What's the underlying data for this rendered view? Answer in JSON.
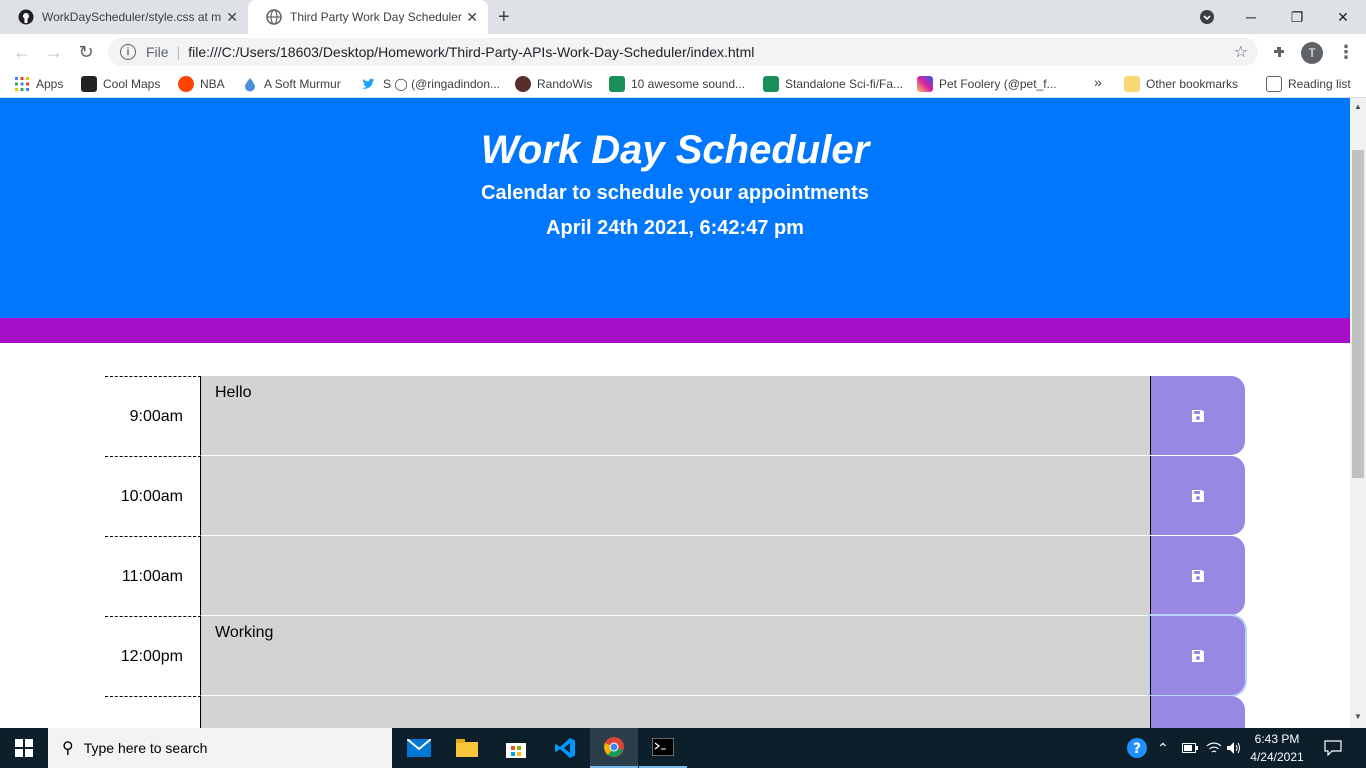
{
  "browser": {
    "tabs": [
      {
        "title": "WorkDayScheduler/style.css at m",
        "active": false
      },
      {
        "title": "Third Party Work Day Scheduler",
        "active": true
      }
    ],
    "new_tab_label": "+",
    "window_controls": {
      "minimize": "─",
      "restore": "❐",
      "close": "✕"
    },
    "url_scheme": "File",
    "url": "file:///C:/Users/18603/Desktop/Homework/Third-Party-APIs-Work-Day-Scheduler/index.html",
    "avatar_initial": "T",
    "bookmarks": [
      {
        "label": "Apps",
        "color": "#4285f4"
      },
      {
        "label": "Cool Maps",
        "color": "#222222"
      },
      {
        "label": "NBA",
        "color": "#ff4500"
      },
      {
        "label": "A Soft Murmur",
        "color": "#4a90d9"
      },
      {
        "label": "S ◯ (@ringadindon...",
        "color": "#1da1f2"
      },
      {
        "label": "RandoWis",
        "color": "#5a2d2d"
      },
      {
        "label": "10 awesome sound...",
        "color": "#1b8f5a"
      },
      {
        "label": "Standalone Sci-fi/Fa...",
        "color": "#1b8f5a"
      },
      {
        "label": "Pet Foolery (@pet_f...",
        "color": "#d6249f"
      }
    ],
    "bookmarks_overflow": "»",
    "other_bookmarks": "Other bookmarks",
    "reading_list": "Reading list"
  },
  "page": {
    "title": "Work Day Scheduler",
    "subtitle": "Calendar to schedule your appointments",
    "current_datetime": "April 24th 2021, 6:42:47 pm",
    "colors": {
      "header": "#0077fd",
      "stripe": "#a70ec7",
      "save": "#9887e3",
      "textarea": "#d3d3d3"
    },
    "rows": [
      {
        "hour": "9:00am",
        "text": "Hello"
      },
      {
        "hour": "10:00am",
        "text": ""
      },
      {
        "hour": "11:00am",
        "text": ""
      },
      {
        "hour": "12:00pm",
        "text": "Working"
      },
      {
        "hour": "",
        "text": ""
      }
    ]
  },
  "taskbar": {
    "search_placeholder": "Type here to search",
    "time": "6:43 PM",
    "date": "4/24/2021"
  }
}
